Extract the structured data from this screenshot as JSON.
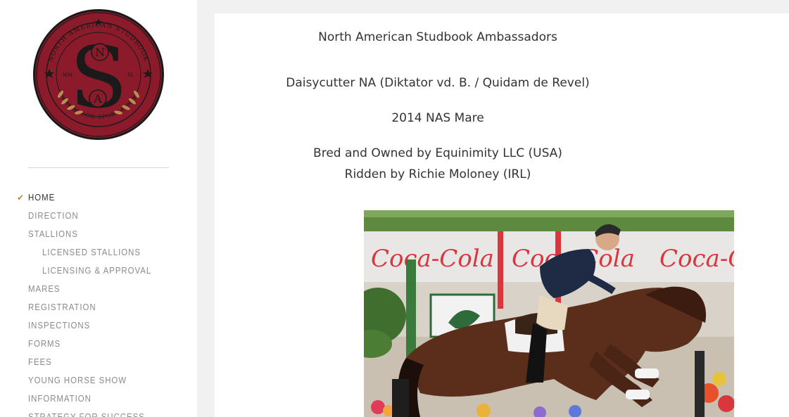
{
  "logo": {
    "ring_text_top": "NORTH AMERICAN STUDBOOK",
    "ring_text_left": "LEXINGTON",
    "ring_text_right": "KENTUCKY",
    "ring_text_bottom": "WARMBLOOD SPORT HORSE",
    "letter_n": "N",
    "letter_s": "S",
    "letter_a": "A",
    "left_mark": "MM",
    "right_mark": "IX",
    "colors": {
      "fill": "#8b1a2b",
      "ring": "#1a1a1a",
      "gold": "#c9a25a"
    }
  },
  "sidebar": {
    "items": [
      {
        "label": "HOME",
        "active": true,
        "level": 0
      },
      {
        "label": "DIRECTION",
        "active": false,
        "level": 0
      },
      {
        "label": "STALLIONS",
        "active": false,
        "level": 0
      },
      {
        "label": "LICENSED STALLIONS",
        "active": false,
        "level": 1
      },
      {
        "label": "LICENSING & APPROVAL",
        "active": false,
        "level": 1
      },
      {
        "label": "MARES",
        "active": false,
        "level": 0
      },
      {
        "label": "REGISTRATION",
        "active": false,
        "level": 0
      },
      {
        "label": "INSPECTIONS",
        "active": false,
        "level": 0
      },
      {
        "label": "FORMS",
        "active": false,
        "level": 0
      },
      {
        "label": "FEES",
        "active": false,
        "level": 0
      },
      {
        "label": "YOUNG HORSE SHOW",
        "active": false,
        "level": 0
      },
      {
        "label": "INFORMATION",
        "active": false,
        "level": 0
      },
      {
        "label": "STRATEGY FOR SUCCESS",
        "active": false,
        "level": 0
      }
    ],
    "check_icon": "checkmark-icon",
    "accent_color": "#c0873a"
  },
  "main": {
    "heading": "North American Studbook Ambassadors",
    "horse_name": "Daisycutter NA (Diktator vd. B. / Quidam de Revel)",
    "horse_info": "2014 NAS Mare",
    "bred_by": "Bred and Owned by Equinimity LLC (USA)",
    "ridden_by": "Ridden by Richie Moloney (IRL)",
    "photo": {
      "banner_text": "Coca-Cola"
    }
  }
}
